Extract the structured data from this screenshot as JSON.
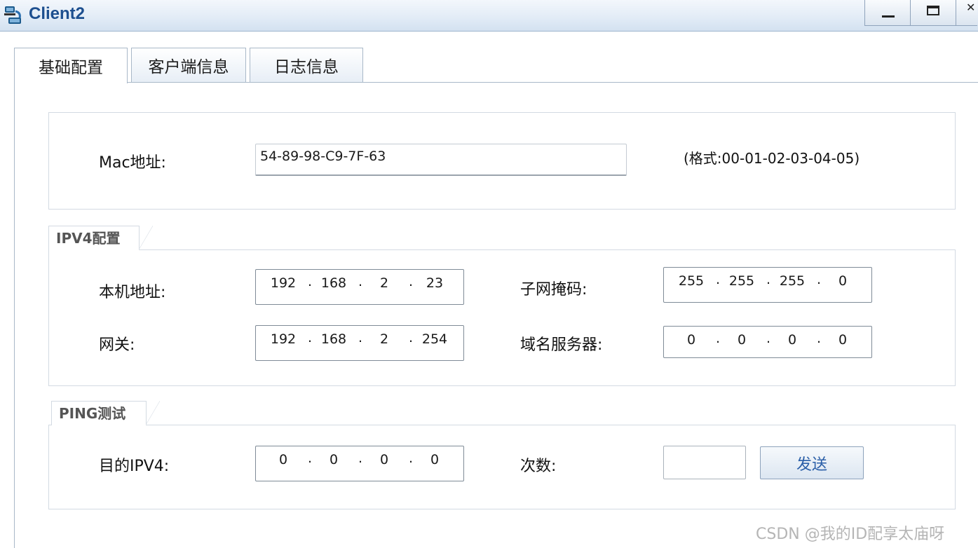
{
  "window": {
    "title": "Client2",
    "icon": "client-network-icon"
  },
  "tabs": [
    {
      "label": "基础配置",
      "active": true
    },
    {
      "label": "客户端信息",
      "active": false
    },
    {
      "label": "日志信息",
      "active": false
    }
  ],
  "mac": {
    "label": "Mac地址:",
    "value": "54-89-98-C9-7F-63",
    "hint": "(格式:00-01-02-03-04-05)"
  },
  "ipv4": {
    "legend": "IPV4配置",
    "host_label": "本机地址:",
    "host": [
      "192",
      "168",
      "2",
      "23"
    ],
    "mask_label": "子网掩码:",
    "mask": [
      "255",
      "255",
      "255",
      "0"
    ],
    "gateway_label": "网关:",
    "gateway": [
      "192",
      "168",
      "2",
      "254"
    ],
    "dns_label": "域名服务器:",
    "dns": [
      "0",
      "0",
      "0",
      "0"
    ]
  },
  "ping": {
    "legend": "PING测试",
    "dest_label": "目的IPV4:",
    "dest": [
      "0",
      "0",
      "0",
      "0"
    ],
    "count_label": "次数:",
    "count_value": "",
    "send_label": "发送"
  },
  "watermark": "CSDN @我的ID配享太庙呀",
  "colors": {
    "title": "#1d4f8f",
    "border": "#a9b8c8",
    "button_text": "#2b5fa8"
  }
}
